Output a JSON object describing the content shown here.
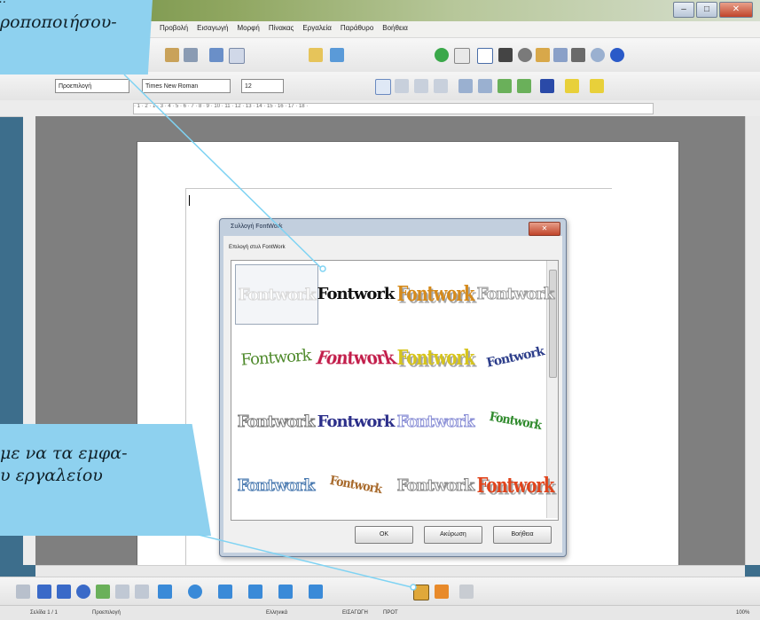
{
  "window": {
    "controls": [
      "–",
      "□",
      "✕"
    ]
  },
  "menubar": {
    "items": [
      "Προβολή",
      "Εισαγωγή",
      "Μορφή",
      "Πίνακας",
      "Εργαλεία",
      "Παράθυρο",
      "Βοήθεια"
    ]
  },
  "format_toolbar": {
    "style_value": "Προεπιλογή",
    "font_value": "Times New Roman",
    "size_value": "12",
    "bold_label": "B",
    "italic_label": "I",
    "underline_label": "U"
  },
  "ruler": {
    "ticks": "· 1 · 2 · 1 · 3 · 4 · 5 · 6 · 7 · 8 · 9 · 10 · 11 · 12 · 13 · 14 · 15 · 16 · 17 · 18 ·"
  },
  "dialog": {
    "title": "Συλλογή FontWork",
    "close_label": "✕",
    "section_label": "Επιλογή στυλ FontWork",
    "gallery": [
      {
        "text": "Fontwork",
        "color": "#d8d8d8",
        "style": "outline"
      },
      {
        "text": "Fontwork",
        "color": "#111111",
        "style": "plain"
      },
      {
        "text": "Fontwork",
        "color": "#d58a1c",
        "style": "shadow"
      },
      {
        "text": "Fontwork",
        "color": "#9a9a9a",
        "style": "outline"
      },
      {
        "text": "Fontwork",
        "color": "#4f8a2c",
        "style": "serif"
      },
      {
        "text": "Fontwork",
        "color": "#c21d4a",
        "style": "perspective"
      },
      {
        "text": "Fontwork",
        "color": "#d6c41c",
        "style": "shadow"
      },
      {
        "text": "Fontwork",
        "color": "#2c3d8a",
        "style": "slant"
      },
      {
        "text": "Fontwork",
        "color": "#7a7a7a",
        "style": "outline"
      },
      {
        "text": "Fontwork",
        "color": "#2c2f8a",
        "style": "plain"
      },
      {
        "text": "Fontwork",
        "color": "#8a8fd6",
        "style": "outline"
      },
      {
        "text": "Fontwork",
        "color": "#2f8a2c",
        "style": "arc"
      },
      {
        "text": "Fontwork",
        "color": "#4a7ab0",
        "style": "outline"
      },
      {
        "text": "Fontwork",
        "color": "#a86a2c",
        "style": "arc"
      },
      {
        "text": "Fontwork",
        "color": "#8a8a8a",
        "style": "outline"
      },
      {
        "text": "Fontwork",
        "color": "#e0441c",
        "style": "shadow"
      }
    ],
    "ok_label": "OK",
    "cancel_label": "Ακύρωση",
    "help_label": "Βοήθεια"
  },
  "statusbar": {
    "page": "Σελίδα 1 / 1",
    "style": "Προεπιλογή",
    "language": "Ελληνικά",
    "mode": "ΕΙΣΑΓΩΓΗ",
    "selection": "ΠΡΟΤ",
    "zoom": "100%"
  },
  "callouts": {
    "top_line1": "…",
    "top_line2": "ροποποιήσου-",
    "bottom_line1": "με να τα εμφα-",
    "bottom_line2": "υ εργαλείου"
  },
  "colors": {
    "callout": "#8ed1ef",
    "leader": "#7fd3f3"
  }
}
